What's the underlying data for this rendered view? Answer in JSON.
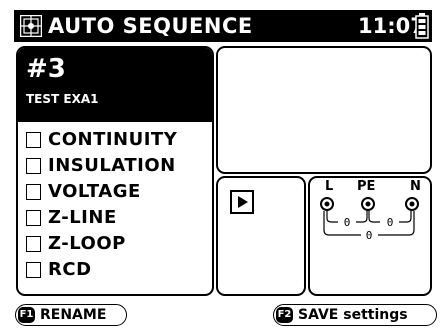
{
  "header": {
    "title": "AUTO SEQUENCE",
    "time": "11:07",
    "icon": "auto-sequence-icon",
    "battery_icon": "battery-icon"
  },
  "sequence": {
    "number": "#3",
    "name": "TEST EXA1"
  },
  "tests": [
    {
      "label": "CONTINUITY",
      "checked": false
    },
    {
      "label": "INSULATION",
      "checked": false
    },
    {
      "label": "VOLTAGE",
      "checked": false
    },
    {
      "label": "Z-LINE",
      "checked": false
    },
    {
      "label": "Z-LOOP",
      "checked": false
    },
    {
      "label": "RCD",
      "checked": false
    }
  ],
  "connection": {
    "terminals": [
      "L",
      "PE",
      "N"
    ],
    "values": [
      "0",
      "0",
      "0"
    ]
  },
  "softkeys": {
    "f1_key": "F1",
    "f1_label": "RENAME",
    "f2_key": "F2",
    "f2_label": "SAVE settings"
  },
  "colors": {
    "foreground": "#000000",
    "background": "#ffffff"
  }
}
